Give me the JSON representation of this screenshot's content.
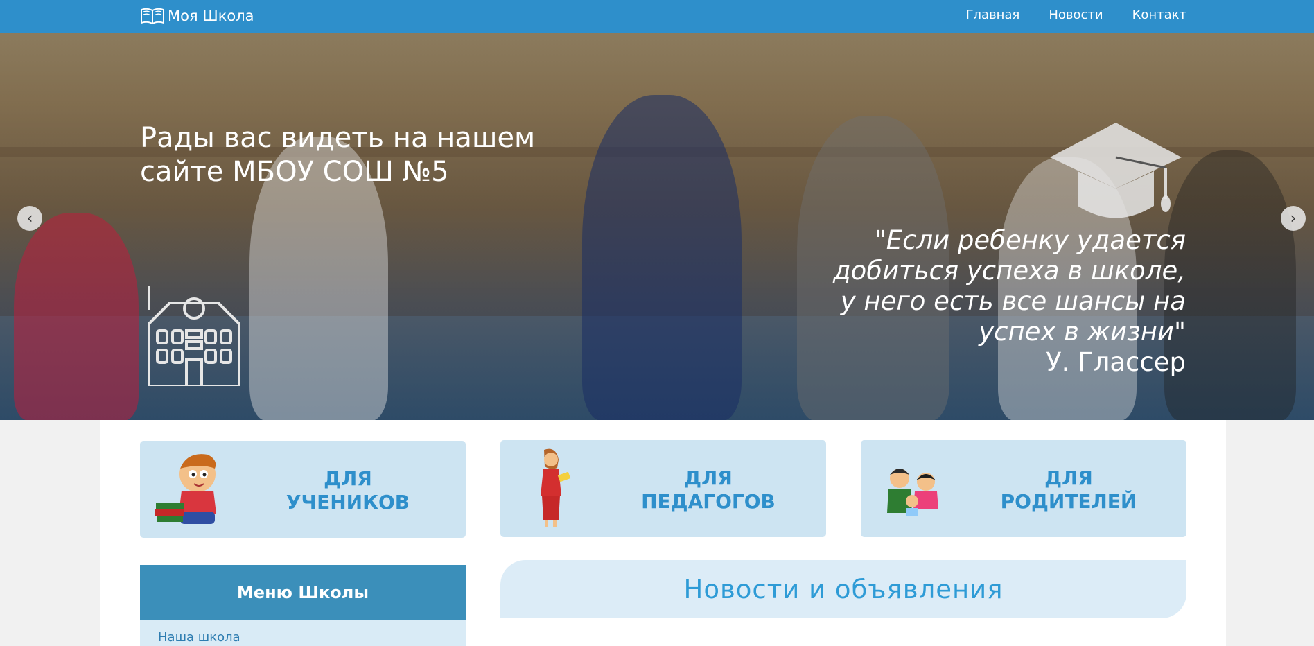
{
  "navbar": {
    "brand": "Моя Школа",
    "links": [
      "Главная",
      "Новости",
      "Контакт"
    ]
  },
  "hero": {
    "title": "Рады вас видеть на нашем сайте МБОУ СОШ №5",
    "quote_lines": [
      "\"Если ребенку удается",
      "добиться успеха в школе,",
      "у него есть все шансы на",
      "успех в жизни\""
    ],
    "author": "У. Глассер"
  },
  "cards": [
    {
      "line1": "ДЛЯ",
      "line2": "УЧЕНИКОВ"
    },
    {
      "line1": "ДЛЯ",
      "line2": "ПЕДАГОГОВ"
    },
    {
      "line1": "ДЛЯ",
      "line2": "РОДИТЕЛЕЙ"
    }
  ],
  "menu": {
    "title": "Меню Школы",
    "items": [
      "Наша школа"
    ]
  },
  "news": {
    "title": "Новости и объявления"
  },
  "colors": {
    "primary": "#2e8fcb",
    "card_bg": "#cde4f2",
    "menu_head": "#3b8fba"
  }
}
